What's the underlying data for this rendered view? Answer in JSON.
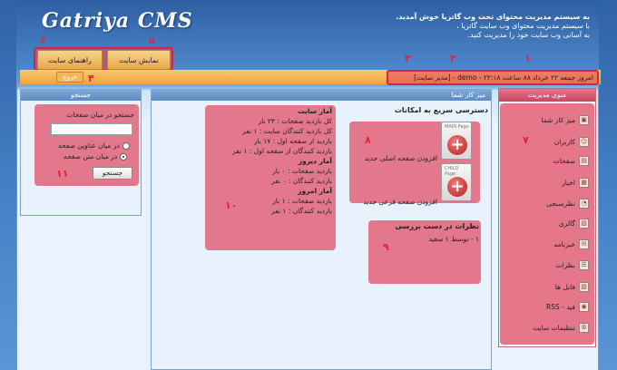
{
  "header": {
    "logo": "Gatriya CMS",
    "welcome_title": "به سیستم مدیریت محتوای تحت وب گاتریا خوش آمدید.",
    "welcome_line1": "با سیستم مدیریت محتوای وب سایت گاتریا ،",
    "welcome_line2": "به آسانی وب سایت خود را مدیریت کنید."
  },
  "topnav": {
    "site_guide": "راهنمای سایت",
    "view_site": "نمایش سایت",
    "exit": "خروج"
  },
  "status": {
    "text": "امروز جمعه ۲۲ خرداد ۸۸ ساعت ۲۲:۱۸ - demo - [مدیر سایت]"
  },
  "annotations": {
    "n1": "۱",
    "n2": "۲",
    "n3": "۳",
    "n4": "۴",
    "n5": "۵",
    "n6": "۶",
    "n7": "۷",
    "n8": "۸",
    "n9": "۹",
    "n10": "۱۰",
    "n11": "۱۱"
  },
  "menu": {
    "title": "منوی مدیریت",
    "items": [
      {
        "label": "میز کار شما",
        "icon": "desktop-icon"
      },
      {
        "label": "کاربران",
        "icon": "users-icon"
      },
      {
        "label": "صفحات",
        "icon": "pages-icon"
      },
      {
        "label": "اخبار",
        "icon": "news-icon"
      },
      {
        "label": "نظرسنجی",
        "icon": "poll-icon"
      },
      {
        "label": "گالری",
        "icon": "gallery-icon"
      },
      {
        "label": "خبرنامه",
        "icon": "newsletter-icon"
      },
      {
        "label": "نظرات",
        "icon": "comments-icon"
      },
      {
        "label": "فایل ها",
        "icon": "files-icon"
      },
      {
        "label": "RSS - فید",
        "icon": "rss-icon"
      },
      {
        "label": "تنظیمات سایت",
        "icon": "settings-icon"
      }
    ]
  },
  "desk": {
    "title": "میز کار شما",
    "quick_title": "دسترسی سریع به امکانات",
    "add_main": "افزودن صفحه اصلی جدید",
    "add_child": "افزودن صفحه فرعی جدید",
    "main_tag": "MAIN Page",
    "child_tag": "CHILD Page",
    "review_title": "نظرات در دست بررسی",
    "review_item": "۱ - توسط ۱ سعید",
    "stats": {
      "site_title": "آمار سایت",
      "total_page_visits": "کل بازدید صفحات : ۲۳ بار",
      "total_site_visitors": "کل بازدید کنندگان سایت : ۱ نفر",
      "first_page_visits": "بازدید از صفحه اول : ۱۷ بار",
      "first_page_visitors": "بازدید کنندگان از صفحه اول : ۱ نفر",
      "yesterday_title": "آمار دیروز",
      "yesterday_visits": "بازدید صفحات : ۰ بار",
      "yesterday_visitors": "بازدید کنندگان : ۰ نفر",
      "today_title": "آمار امروز",
      "today_visits": "بازدید صفحات : ۱ بار",
      "today_visitors": "بازدید کنندگان : ۱ نفر"
    }
  },
  "search": {
    "title": "جستجو",
    "label": "جستجو در میان صفحات",
    "value": "",
    "opt_titles": "در میان عناوین صفحه",
    "opt_text": "در میان متن صفحه",
    "button": "جستجو"
  }
}
